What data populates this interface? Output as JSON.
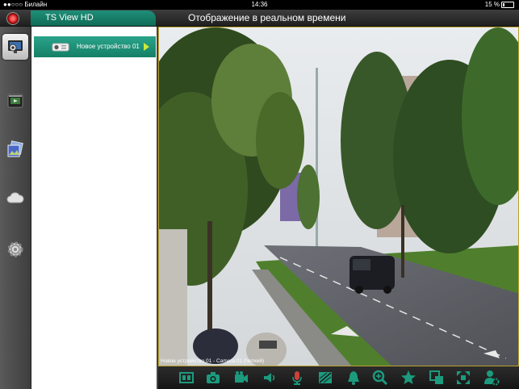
{
  "status_bar": {
    "carrier": "●●○○○ Билайн",
    "time": "14:36",
    "battery": "15 %"
  },
  "app": {
    "name": "TS View HD",
    "page_title": "Отображение в реальном времени"
  },
  "sidebar": {
    "items": [
      {
        "name": "live-view",
        "icon": "monitor-camera-icon",
        "active": true
      },
      {
        "name": "playback",
        "icon": "film-playback-icon",
        "active": false
      },
      {
        "name": "gallery",
        "icon": "photo-album-icon",
        "active": false
      },
      {
        "name": "cloud",
        "icon": "cloud-icon",
        "active": false
      },
      {
        "name": "settings",
        "icon": "gear-icon",
        "active": false
      }
    ]
  },
  "device_list": {
    "items": [
      {
        "label": "Новое устройство 01",
        "icon": "camera-icon",
        "selected": true
      }
    ]
  },
  "video": {
    "caption": "Новое устройство 01 - Camera 01 (Четкий)"
  },
  "toolbar": {
    "buttons": [
      {
        "name": "split-view",
        "icon": "layout-icon"
      },
      {
        "name": "snapshot",
        "icon": "camera-snapshot-icon"
      },
      {
        "name": "record",
        "icon": "video-record-icon"
      },
      {
        "name": "audio",
        "icon": "speaker-icon"
      },
      {
        "name": "talk",
        "icon": "microphone-icon"
      },
      {
        "name": "quality",
        "icon": "quality-icon"
      },
      {
        "name": "alarm",
        "icon": "bell-icon"
      },
      {
        "name": "zoom",
        "icon": "zoom-in-icon"
      },
      {
        "name": "favorites",
        "icon": "star-icon"
      },
      {
        "name": "ptz",
        "icon": "ptz-icon"
      },
      {
        "name": "fullscreen",
        "icon": "fullscreen-icon"
      },
      {
        "name": "user-settings",
        "icon": "user-gear-icon"
      }
    ]
  },
  "colors": {
    "accent": "#148066",
    "toolbar_icon": "#1c9a7e",
    "video_border": "#b8a02a"
  }
}
